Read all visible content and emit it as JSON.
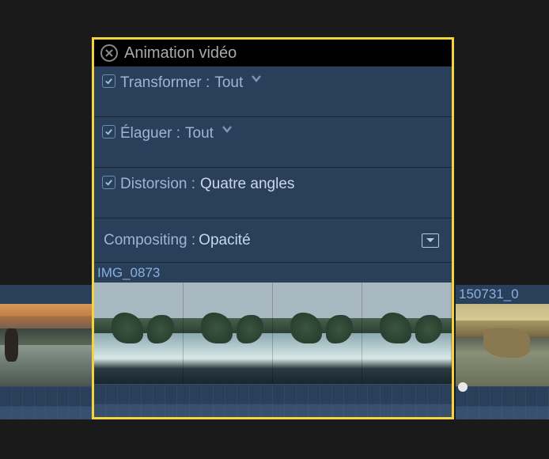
{
  "panel": {
    "title": "Animation vidéo",
    "rows": [
      {
        "label": "Transformer :",
        "value": "Tout",
        "hasDropdown": true,
        "checked": true
      },
      {
        "label": "Élaguer :",
        "value": "Tout",
        "hasDropdown": true,
        "checked": true
      },
      {
        "label": "Distorsion :",
        "value": "Quatre angles",
        "hasDropdown": false,
        "checked": true
      }
    ],
    "compositing": {
      "label": "Compositing :",
      "value": "Opacité"
    }
  },
  "clips": {
    "center": {
      "name": "IMG_0873"
    },
    "right": {
      "name": "150731_0"
    }
  }
}
